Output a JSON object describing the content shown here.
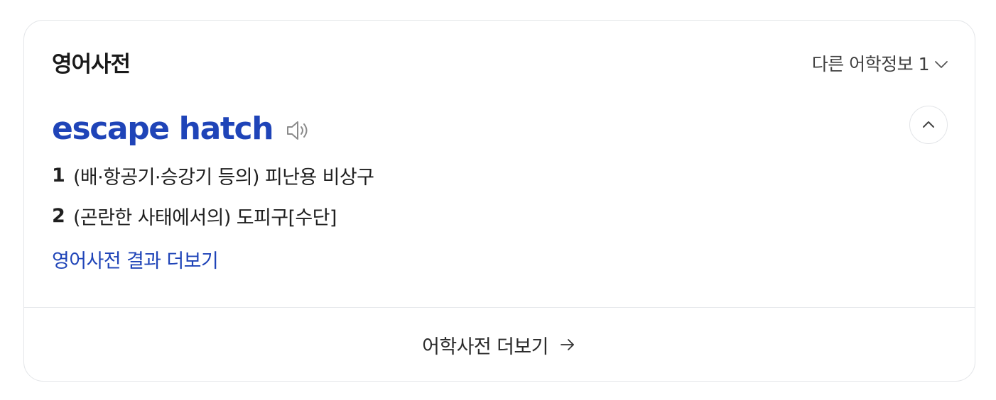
{
  "card": {
    "title": "영어사전",
    "other_info_label": "다른 어학정보 1",
    "entry": {
      "headword": "escape hatch",
      "meanings": [
        {
          "num": "1",
          "text": "(배·항공기·승강기 등의) 피난용 비상구"
        },
        {
          "num": "2",
          "text": "(곤란한 사태에서의) 도피구[수단]"
        }
      ]
    },
    "more_results_label": "영어사전 결과 더보기",
    "footer_label": "어학사전 더보기"
  },
  "icons": {
    "other_info": "chevron-down-icon",
    "speaker": "speaker-icon",
    "collapse": "chevron-up-icon",
    "footer": "arrow-right-icon"
  },
  "colors": {
    "accent": "#1f44b8",
    "border": "#e3e5e8",
    "text": "#1f1f1f"
  }
}
